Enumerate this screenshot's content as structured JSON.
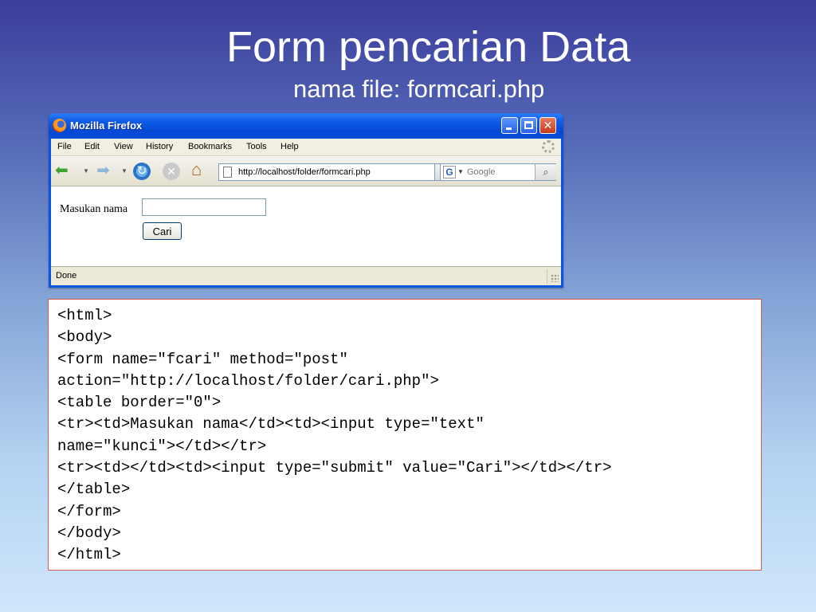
{
  "slide": {
    "title": "Form pencarian Data",
    "subtitle": "nama file: formcari.php"
  },
  "browser": {
    "window_title": "Mozilla Firefox",
    "window_buttons": {
      "minimize": "minimize-icon",
      "maximize": "maximize-icon",
      "close": "✕"
    },
    "menu": [
      "File",
      "Edit",
      "View",
      "History",
      "Bookmarks",
      "Tools",
      "Help"
    ],
    "nav_icons": {
      "back": "back-arrow-icon",
      "forward": "forward-arrow-icon",
      "reload": "reload-icon",
      "stop": "stop-icon",
      "home": "home-icon"
    },
    "url": "http://localhost/folder/formcari.php",
    "search_engine": "G",
    "search_placeholder": "Google",
    "status": "Done",
    "accent_color": "#0a55e0"
  },
  "page_form": {
    "label": "Masukan nama",
    "input_value": "",
    "submit_label": "Cari"
  },
  "code": {
    "lines": [
      "<html>",
      "<body>",
      "<form name=\"fcari\" method=\"post\"",
      "action=\"http://localhost/folder/cari.php\">",
      "<table border=\"0\">",
      "<tr><td>Masukan nama</td><td><input type=\"text\"",
      "name=\"kunci\"></td></tr>",
      "<tr><td></td><td><input type=\"submit\" value=\"Cari\"></td></tr>",
      "</table>",
      "</form>",
      "</body>",
      "</html>"
    ]
  }
}
